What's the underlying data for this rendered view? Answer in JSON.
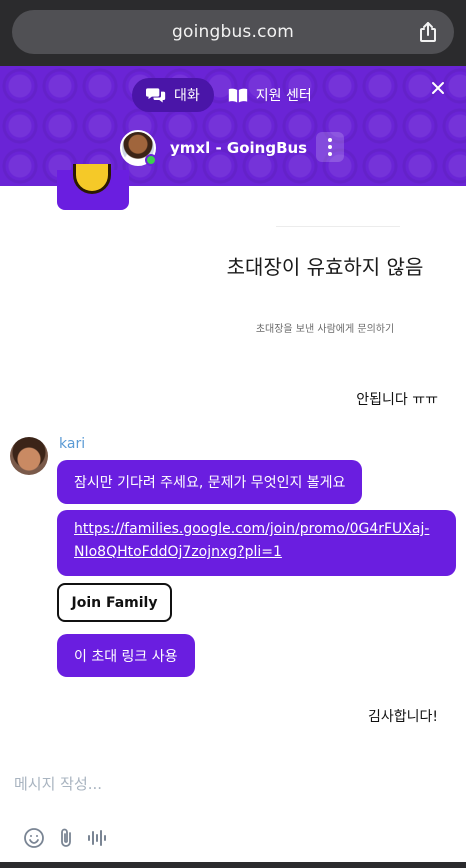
{
  "browser": {
    "url": "goingbus.com",
    "share_icon": "share-icon"
  },
  "header": {
    "tabs": [
      {
        "label": "대화",
        "icon": "chat-bubbles-icon",
        "active": true
      },
      {
        "label": "지원 센터",
        "icon": "book-icon",
        "active": false
      }
    ],
    "agent_name": "ymxl - GoingBus",
    "status": "online",
    "accent": "#6a24d6"
  },
  "conversation": {
    "invite_card": {
      "title": "초대장이 유효하지 않음",
      "subtitle": "초대장을 보낸 사람에게 문의하기"
    },
    "user_msg_1": "안됩니다 ㅠㅠ",
    "agent": {
      "name": "kari",
      "msg_1": "잠시만 기다려 주세요, 문제가 무엇인지 볼게요",
      "link": "https://families.google.com/join/promo/0G4rFUXaj-NIo8QHtoFddOj7zojnxg?pli=1",
      "join_button": "Join Family",
      "msg_3": "이 초대 링크 사용"
    },
    "user_msg_2": "김사합니다!"
  },
  "composer": {
    "placeholder": "메시지 작성...",
    "tools": [
      "emoji-icon",
      "attachment-icon",
      "voice-icon"
    ]
  },
  "colors": {
    "bubble": "#6a1ee0",
    "agent_name": "#5b9bd5"
  }
}
